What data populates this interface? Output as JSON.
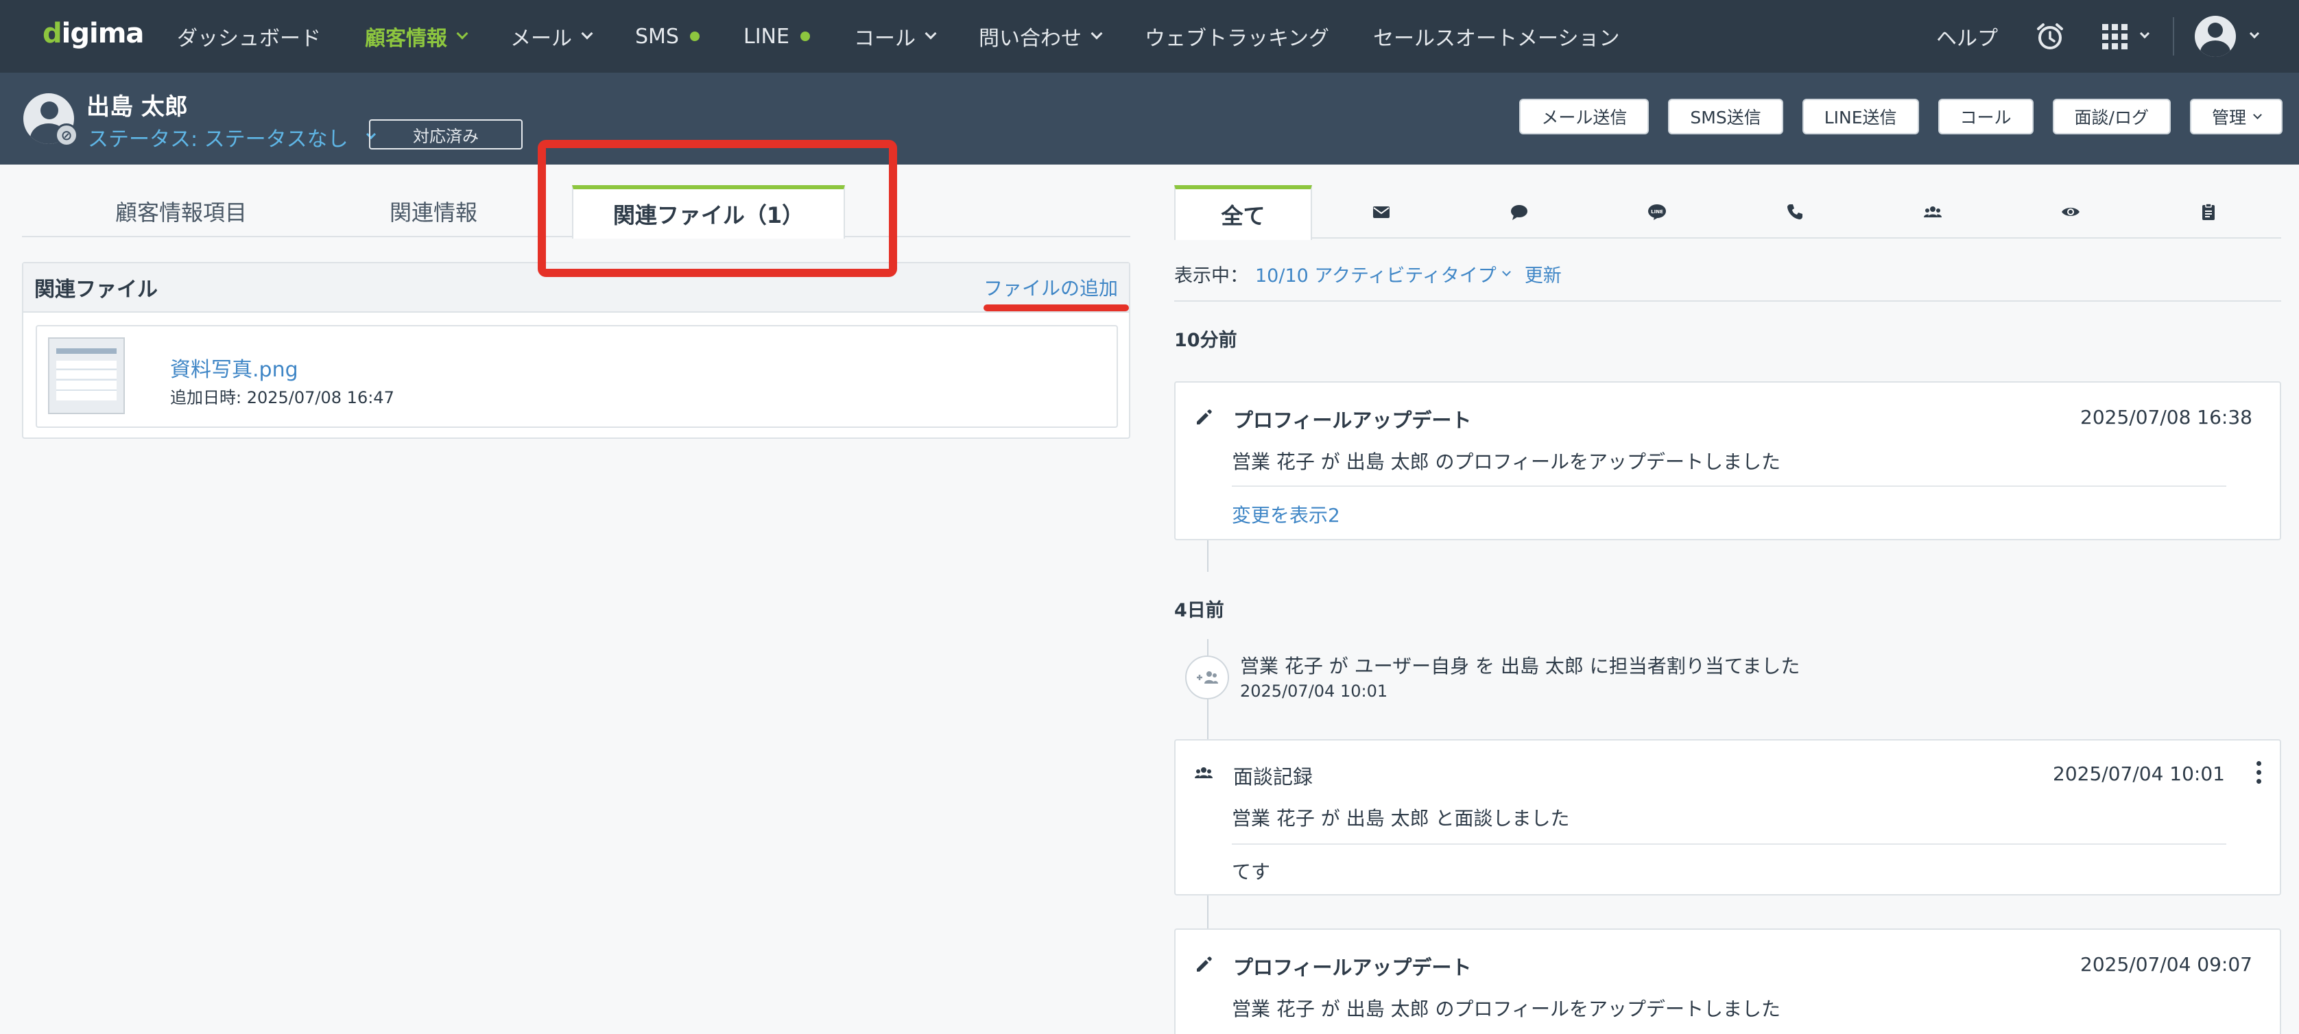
{
  "app": {
    "logo": "digima"
  },
  "nav": {
    "items": [
      {
        "label": "ダッシュボード",
        "dropdown": false,
        "dot": false,
        "active": false
      },
      {
        "label": "顧客情報",
        "dropdown": true,
        "dot": false,
        "active": true
      },
      {
        "label": "メール",
        "dropdown": true,
        "dot": false,
        "active": false
      },
      {
        "label": "SMS",
        "dropdown": false,
        "dot": true,
        "active": false
      },
      {
        "label": "LINE",
        "dropdown": false,
        "dot": true,
        "active": false
      },
      {
        "label": "コール",
        "dropdown": true,
        "dot": false,
        "active": false
      },
      {
        "label": "問い合わせ",
        "dropdown": true,
        "dot": false,
        "active": false
      },
      {
        "label": "ウェブトラッキング",
        "dropdown": false,
        "dot": false,
        "active": false
      },
      {
        "label": "セールスオートメーション",
        "dropdown": false,
        "dot": false,
        "active": false
      }
    ],
    "help": "ヘルプ"
  },
  "customer": {
    "name": "出島 太郎",
    "status": "ステータス: ステータスなし",
    "handled_button": "対応済み",
    "actions": [
      "メール送信",
      "SMS送信",
      "LINE送信",
      "コール",
      "面談/ログ",
      "管理"
    ]
  },
  "left": {
    "tabs": [
      "顧客情報項目",
      "関連情報",
      "関連ファイル（1）"
    ],
    "active_tab": 2,
    "files_panel": {
      "title": "関連ファイル",
      "add_link": "ファイルの追加",
      "files": [
        {
          "name": "資料写真.png",
          "added": "追加日時: 2025/07/08 16:47"
        }
      ]
    }
  },
  "right": {
    "tabs": [
      {
        "label": "全て",
        "icon": ""
      },
      {
        "label": "",
        "icon": "mail-icon"
      },
      {
        "label": "",
        "icon": "chat-icon"
      },
      {
        "label": "",
        "icon": "line-icon"
      },
      {
        "label": "",
        "icon": "phone-icon"
      },
      {
        "label": "",
        "icon": "meeting-icon"
      },
      {
        "label": "",
        "icon": "eye-icon"
      },
      {
        "label": "",
        "icon": "clipboard-icon"
      }
    ],
    "filter": {
      "label": "表示中：",
      "value": "10/10 アクティビティタイプ",
      "refresh": "更新"
    },
    "groups": [
      {
        "label": "10分前"
      },
      {
        "label": "4日前"
      }
    ],
    "activities": [
      {
        "title": "プロフィールアップデート",
        "date": "2025/07/08 16:38",
        "body": "営業 花子 が 出島 太郎 のプロフィールをアップデートしました",
        "link": "変更を表示2"
      },
      {
        "text": "営業 花子 が ユーザー自身 を 出島 太郎 に担当者割り当てました",
        "date": "2025/07/04 10:01"
      },
      {
        "title": "面談記録",
        "date": "2025/07/04 10:01",
        "body": "営業 花子 が 出島 太郎 と面談しました",
        "note": "てす"
      },
      {
        "title": "プロフィールアップデート",
        "date": "2025/07/04 09:07",
        "body": "営業 花子 が 出島 太郎 のプロフィールをアップデートしました"
      }
    ]
  },
  "colors": {
    "nav_bg": "#2e3b48",
    "accent_green": "#8dc63f",
    "link_blue": "#3f86c6",
    "highlight_red": "#e53127"
  }
}
